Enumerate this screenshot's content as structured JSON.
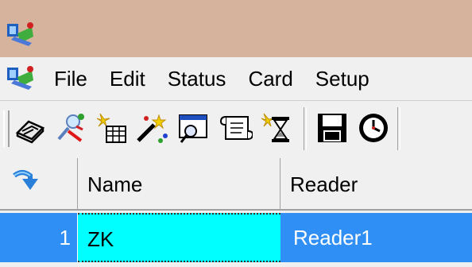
{
  "menu": {
    "items": [
      {
        "label": "File"
      },
      {
        "label": "Edit"
      },
      {
        "label": "Status"
      },
      {
        "label": "Card"
      },
      {
        "label": "Setup"
      }
    ]
  },
  "toolbar": {
    "buttons": [
      {
        "icon": "scanner-icon"
      },
      {
        "icon": "add-device-icon"
      },
      {
        "icon": "new-grid-icon"
      },
      {
        "icon": "wizard-icon"
      },
      {
        "icon": "search-window-icon"
      },
      {
        "icon": "scroll-icon"
      },
      {
        "icon": "hourglass-icon"
      },
      {
        "icon": "save-icon"
      },
      {
        "icon": "clock-icon"
      }
    ]
  },
  "grid": {
    "headers": {
      "name": "Name",
      "reader": "Reader"
    },
    "rows": [
      {
        "index": "1",
        "name": "ZK",
        "reader": "Reader1"
      }
    ],
    "colors": {
      "selected_row": "#2f8ff5",
      "focused_cell": "#00ffff"
    }
  }
}
